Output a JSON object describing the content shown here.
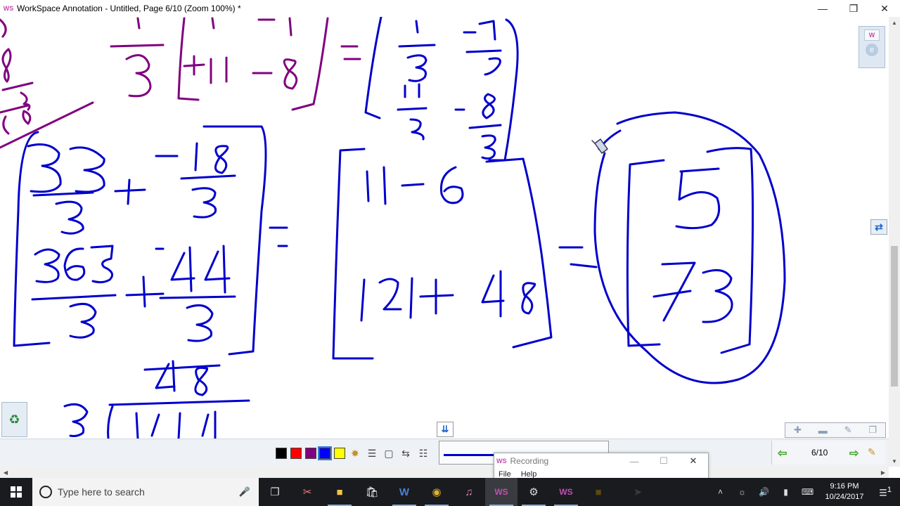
{
  "window": {
    "logo_text": "WS",
    "title": "WorkSpace Annotation - Untitled, Page 6/10 (Zoom 100%) *",
    "minimize_icon": "minimize-icon",
    "restore_icon": "restore-icon",
    "close_icon": "close-icon"
  },
  "side_widgets": {
    "palette_w": "W",
    "palette_e": "e"
  },
  "toolbar": {
    "colors": [
      "#000000",
      "#ff0000",
      "#800080",
      "#0000ff",
      "#ffff00"
    ],
    "selected_color": "#0000ff",
    "tool_icons": [
      "palette-icon",
      "line-width-icon",
      "eraser-icon",
      "line-style-icon",
      "grid-icon"
    ],
    "ink_color": "#0000cc",
    "page_indicator": "6/10"
  },
  "recording_window": {
    "logo_text": "WS",
    "title": "Recording",
    "menu": [
      "File",
      "Help"
    ]
  },
  "taskbar": {
    "search_placeholder": "Type here to search",
    "apps": [
      "task-view",
      "snipping",
      "file-explorer",
      "store",
      "word",
      "chrome",
      "itunes",
      "workspace",
      "recorder",
      "workspace-2",
      "sticky",
      "arrow"
    ],
    "time": "9:16 PM",
    "date": "10/24/2017",
    "notification_count": "1"
  }
}
